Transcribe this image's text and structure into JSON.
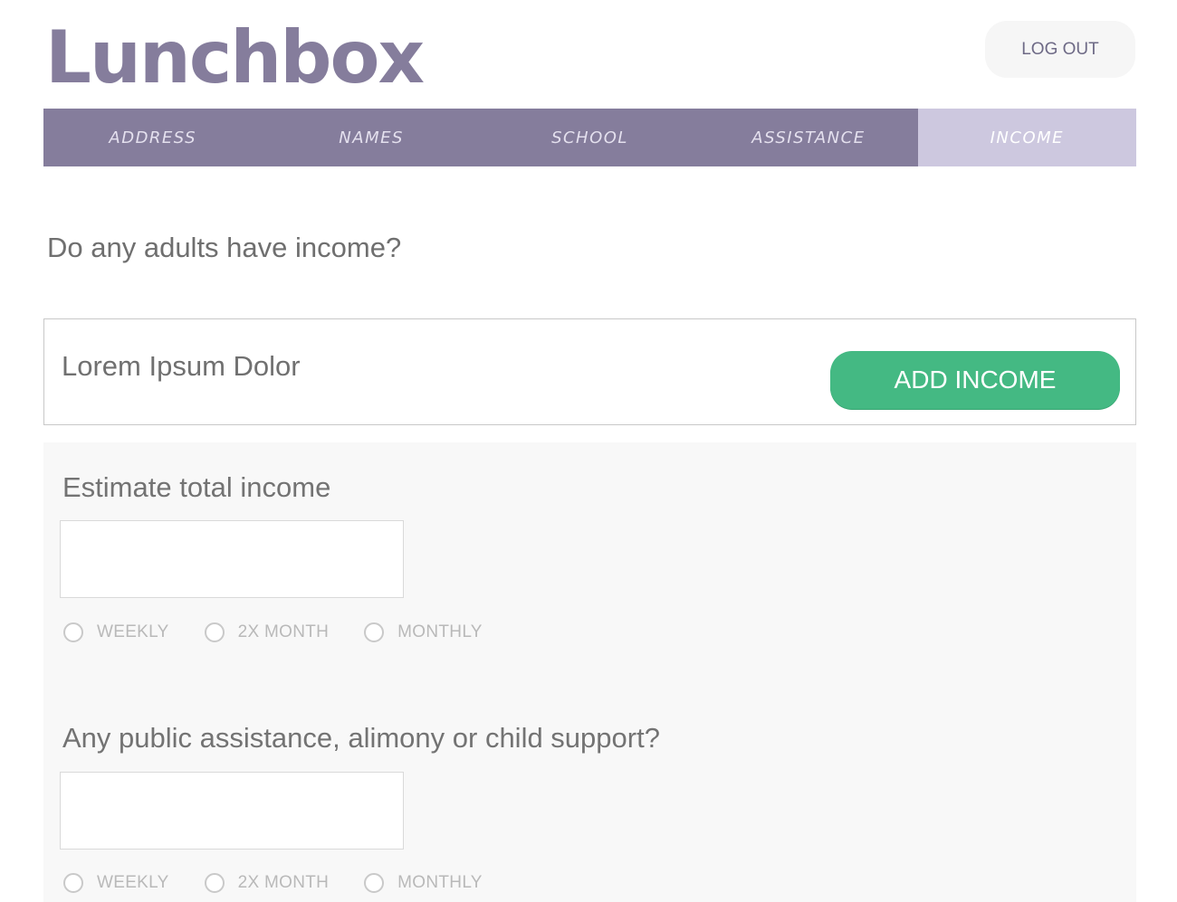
{
  "app": {
    "logo_text": "Lunchbox",
    "logout_label": "LOG OUT"
  },
  "tabs": [
    {
      "label": "ADDRESS",
      "active": false
    },
    {
      "label": "NAMES",
      "active": false
    },
    {
      "label": "SCHOOL",
      "active": false
    },
    {
      "label": "ASSISTANCE",
      "active": false
    },
    {
      "label": "INCOME",
      "active": true
    }
  ],
  "question": "Do any adults have income?",
  "income_card": {
    "name": "Lorem Ipsum Dolor",
    "add_label": "ADD INCOME"
  },
  "estimate": {
    "label": "Estimate total income",
    "value": "",
    "frequency_options": [
      "WEEKLY",
      "2X MONTH",
      "MONTHLY"
    ]
  },
  "assistance": {
    "label": "Any public assistance, alimony or child support?",
    "value": "",
    "frequency_options": [
      "WEEKLY",
      "2X MONTH",
      "MONTHLY"
    ]
  },
  "colors": {
    "brand": "#857d9c",
    "tab_active": "#cdc8df",
    "accent_green": "#44b983",
    "panel_bg": "#f8f8f8"
  }
}
